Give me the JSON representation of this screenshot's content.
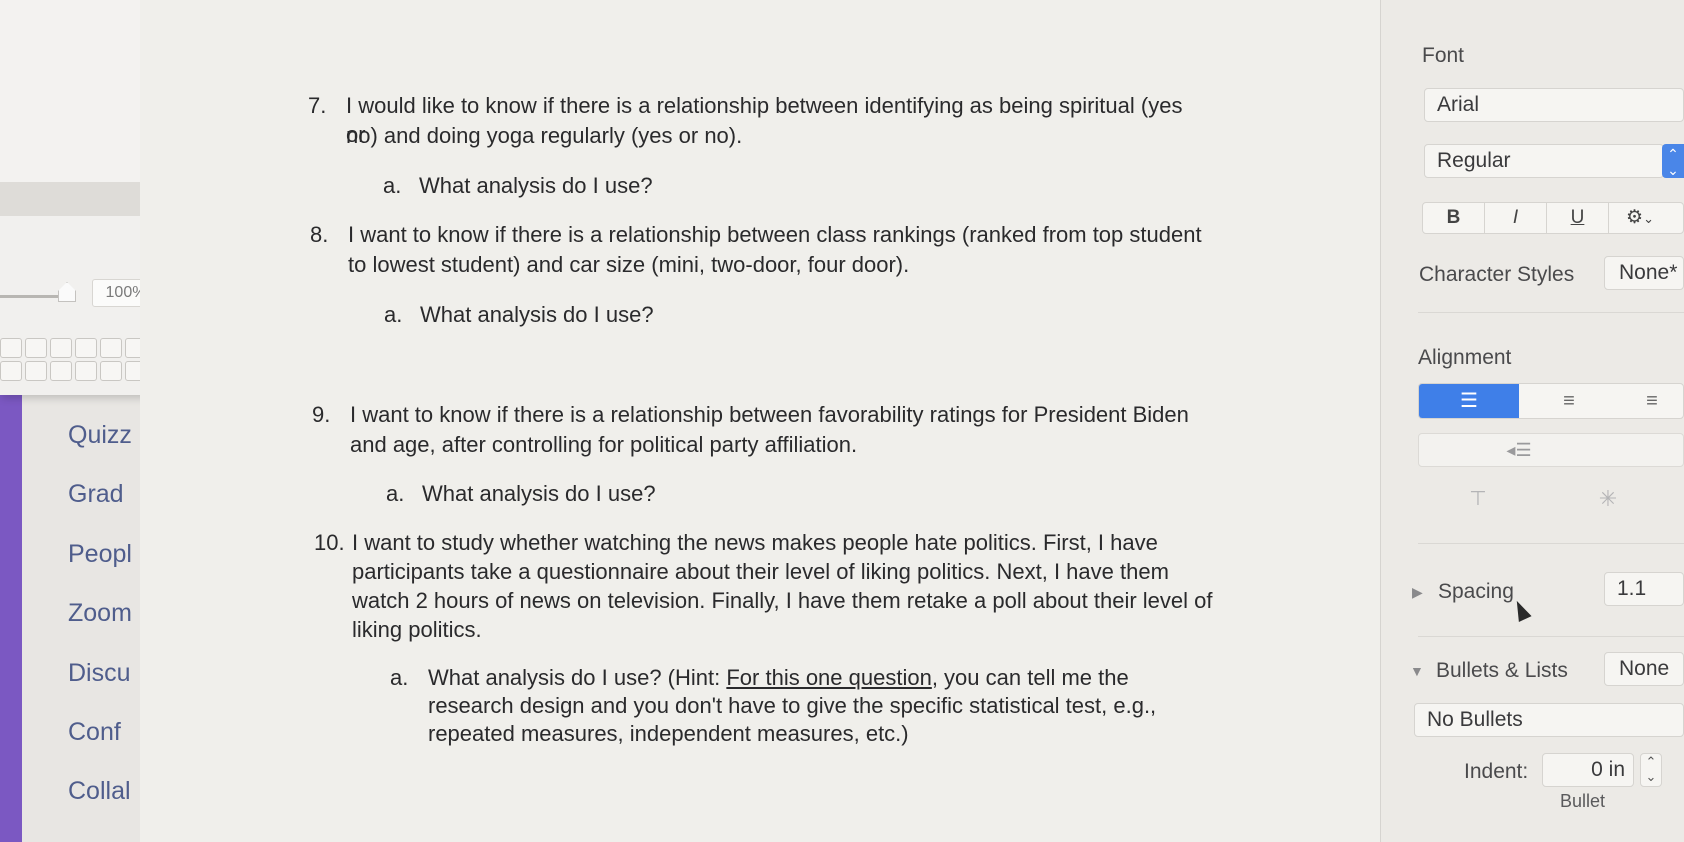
{
  "zoom_popover": {
    "zoom_value": "100%"
  },
  "lms_nav": [
    "Quizz",
    "Grad",
    "Peopl",
    "Zoom",
    "Discu",
    "Conf",
    "Collal"
  ],
  "document": {
    "q7": {
      "num": "7.",
      "line1": "I would like to know if there is a relationship between identifying as being spiritual (yes or",
      "line2": "no) and doing yoga regularly (yes or no).",
      "sub_num": "a.",
      "sub_text": "What analysis do I use?"
    },
    "q8": {
      "num": "8.",
      "line1": "I want to know if there is a relationship between class rankings (ranked from top student",
      "line2": "to lowest student) and car size (mini, two-door, four door).",
      "sub_num": "a.",
      "sub_text": "What analysis do I use?"
    },
    "q9": {
      "num": "9.",
      "line1": "I want to know if there is a relationship between favorability ratings for President Biden",
      "line2": "and age, after controlling for political party affiliation.",
      "sub_num": "a.",
      "sub_text": "What analysis do I use?"
    },
    "q10": {
      "num": "10.",
      "line1": "I want to study whether watching the news makes people hate politics. First, I have",
      "line2": "participants take a questionnaire about their level of liking politics. Next, I have them",
      "line3": "watch 2 hours of news on television. Finally, I have them retake a poll about their level of",
      "line4": "liking politics.",
      "sub_num": "a.",
      "sub_line1_pre": "What analysis do I use? (Hint: ",
      "sub_line1_underline": "For this one question",
      "sub_line1_post": ", you can tell me the",
      "sub_line2": "research design and you don't have to give the specific statistical test, e.g.,",
      "sub_line3": "repeated measures, independent measures, etc.)"
    }
  },
  "inspector": {
    "font_label": "Font",
    "font_family": "Arial",
    "font_style": "Regular",
    "bold": "B",
    "italic": "I",
    "underline": "U",
    "character_styles_label": "Character Styles",
    "character_styles_value": "None*",
    "alignment_label": "Alignment",
    "spacing_label": "Spacing",
    "spacing_value": "1.1",
    "bullets_label": "Bullets & Lists",
    "bullets_value": "None",
    "bullets_type": "No Bullets",
    "indent_label": "Indent:",
    "indent_value": "0 in",
    "bullet_caption": "Bullet",
    "accent_color": "#3f7fe8"
  }
}
